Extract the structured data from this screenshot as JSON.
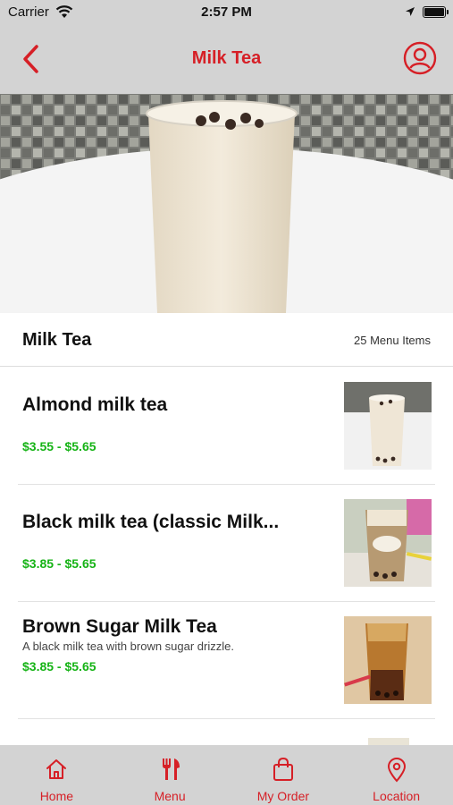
{
  "status_bar": {
    "carrier": "Carrier",
    "time": "2:57 PM"
  },
  "nav": {
    "title": "Milk Tea",
    "back_icon": "chevron-left-icon",
    "profile_icon": "user-circle-icon"
  },
  "colors": {
    "accent": "#d61f26",
    "price": "#16b316",
    "bar_background": "#d3d3d3"
  },
  "category": {
    "name": "Milk Tea",
    "item_count": "25 Menu Items"
  },
  "menu_items": [
    {
      "name": "Almond milk tea",
      "description": "",
      "price": "$3.55 - $5.65"
    },
    {
      "name": "Black milk tea (classic Milk...",
      "description": "",
      "price": "$3.85 - $5.65"
    },
    {
      "name": "Brown Sugar Milk Tea",
      "description": "A black milk tea with brown sugar drizzle.",
      "price": "$3.85 - $5.65"
    }
  ],
  "tabs": [
    {
      "label": "Home",
      "icon": "home-icon"
    },
    {
      "label": "Menu",
      "icon": "fork-knife-icon"
    },
    {
      "label": "My Order",
      "icon": "shopping-bag-icon"
    },
    {
      "label": "Location",
      "icon": "map-pin-icon"
    }
  ]
}
